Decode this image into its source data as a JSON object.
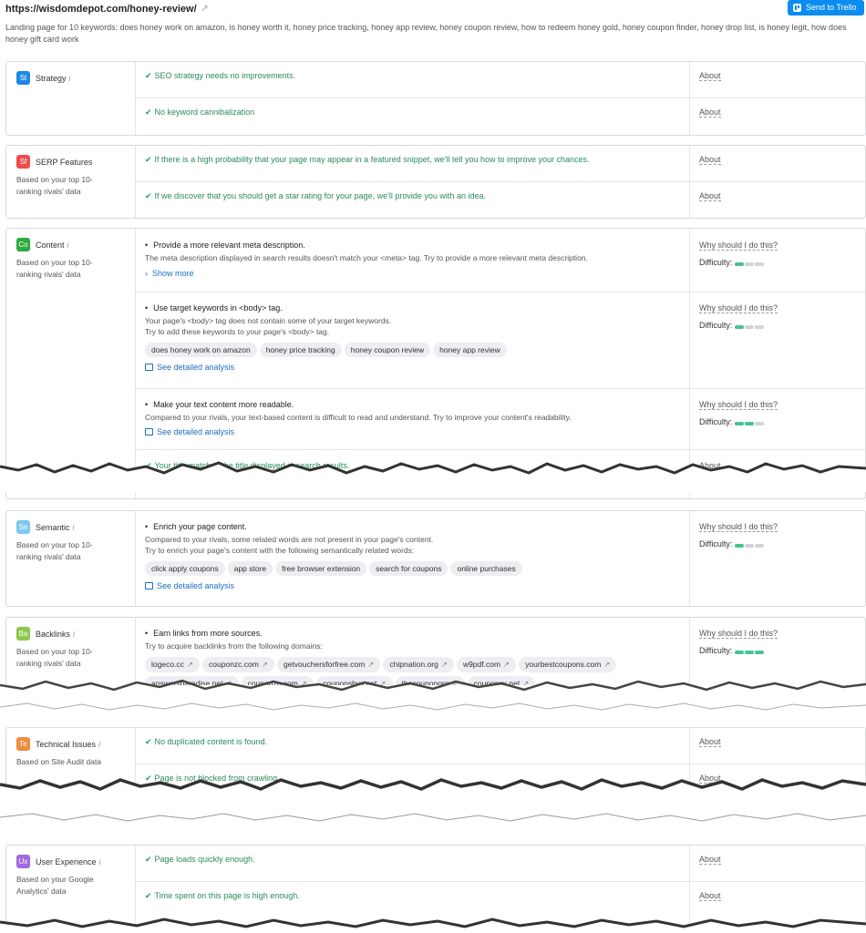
{
  "header": {
    "url": "https://wisdomdepot.com/honey-review/",
    "trello_label": "Send to Trello",
    "landing": "Landing page for 10 keywords: does honey work on amazon, is honey worth it, honey price tracking, honey app review, honey coupon review, how to redeem honey gold, honey coupon finder, honey drop list, is honey legit, how does honey gift card work"
  },
  "labels": {
    "about": "About",
    "why": "Why should I do this?",
    "difficulty": "Difficulty:",
    "show_more": "Show more",
    "see_detailed": "See detailed analysis"
  },
  "strategy": {
    "badge": "St",
    "color": "#1e88e5",
    "title": "Strategy",
    "rows": [
      "SEO strategy needs no improvements.",
      "No keyword cannibalization"
    ]
  },
  "serp": {
    "badge": "Sf",
    "color": "#ef4b4b",
    "title": "SERP Features",
    "sub": "Based on your top 10-ranking rivals' data",
    "rows": [
      "If there is a high probability that your page may appear in a featured snippet, we'll tell you how to improve your chances.",
      "If we discover that you should get a star rating for your page, we'll provide you with an idea."
    ]
  },
  "content": {
    "badge": "Co",
    "color": "#2eaa3f",
    "title": "Content",
    "sub": "Based on your top 10-ranking rivals' data",
    "item1": {
      "title": "Provide a more relevant meta description.",
      "desc": "The meta description displayed in search results doesn't match your <meta> tag. Try to provide a more relevant meta description.",
      "level": 0.33
    },
    "item2": {
      "title": "Use target keywords in <body> tag.",
      "desc1": "Your page's <body> tag does not contain some of your target keywords.",
      "desc2": "Try to add these keywords to your page's <body> tag.",
      "chips": [
        "does honey work on amazon",
        "honey price tracking",
        "honey coupon review",
        "honey app review"
      ],
      "level": 0.33
    },
    "item3": {
      "title": "Make your text content more readable.",
      "desc": "Compared to your rivals, your text-based content is difficult to read and understand. Try to improve your content's readability.",
      "level": 0.67
    },
    "item4": "Your title matches the title displayed in search results."
  },
  "semantic": {
    "badge": "Se",
    "color": "#7ec8f0",
    "title": "Semantic",
    "sub": "Based on your top 10-ranking rivals' data",
    "title_item": "Enrich your page content.",
    "desc1": "Compared to your rivals, some related words are not present in your page's content.",
    "desc2": "Try to enrich your page's content with the following semantically related words:",
    "chips": [
      "click apply coupons",
      "app store",
      "free browser extension",
      "search for coupons",
      "online purchases"
    ],
    "level": 0.33
  },
  "backlinks": {
    "badge": "Ba",
    "color": "#8cc84b",
    "title": "Backlinks",
    "sub": "Based on your top 10-ranking rivals' data",
    "title_item": "Earn links from more sources.",
    "desc": "Try to acquire backlinks from the following domains:",
    "chips": [
      "logeco.cc",
      "couponzc.com",
      "getvouchersforfree.com",
      "chipnation.org",
      "w9pdf.com",
      "yourbestcoupons.com"
    ],
    "chips2": [
      "answersparadise.net",
      "couponzo.com",
      "couponsbuy.net",
      "thecouponorg",
      "couponsx.net"
    ],
    "level": 1.0
  },
  "technical": {
    "badge": "Te",
    "color": "#f08c3c",
    "title": "Technical Issues",
    "sub": "Based on Site Audit data",
    "rows": [
      "No duplicated content is found.",
      "Page is not blocked from crawling"
    ]
  },
  "ux": {
    "badge": "Ux",
    "color": "#a06ae0",
    "title": "User Experience",
    "sub": "Based on your Google Analytics' data",
    "rows": [
      "Page loads quickly enough.",
      "Time spent on this page is high enough."
    ]
  }
}
